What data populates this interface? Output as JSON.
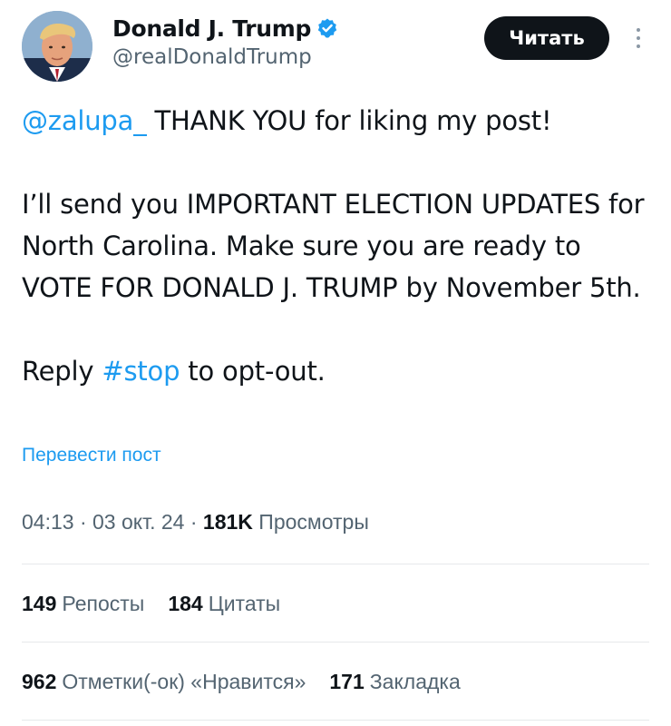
{
  "author": {
    "name": "Donald J. Trump",
    "handle": "@realDonaldTrump",
    "avatar_icon": "profile-photo",
    "verified_icon": "verified-badge-icon",
    "verified_color": "#1d9bf0"
  },
  "header": {
    "follow_label": "Читать",
    "more_icon": "vertical-ellipsis-icon"
  },
  "tweet": {
    "mention": "@zalupa_",
    "line1_rest": " THANK YOU for liking my post!",
    "paragraph2": "I’ll send you IMPORTANT ELECTION UPDATES for North Carolina. Make sure you are ready to VOTE FOR DONALD J. TRUMP by November 5th.",
    "paragraph3_before": "Reply ",
    "hashtag": "#stop",
    "paragraph3_after": " to opt-out."
  },
  "translate_label": "Перевести пост",
  "meta": {
    "time": "04:13",
    "separator": " · ",
    "date": "03 окт. 24",
    "views_count": "181K",
    "views_label": "Просмотры"
  },
  "stats": {
    "reposts_count": "149",
    "reposts_label": "Репосты",
    "quotes_count": "184",
    "quotes_label": "Цитаты",
    "likes_count": "962",
    "likes_label": "Отметки(-ок) «Нравится»",
    "bookmarks_count": "171",
    "bookmarks_label": "Закладка"
  },
  "colors": {
    "accent": "#1d9bf0",
    "text": "#0f1419",
    "secondary": "#536471",
    "button_bg": "#0f1419",
    "divider": "#e6e9eb"
  }
}
